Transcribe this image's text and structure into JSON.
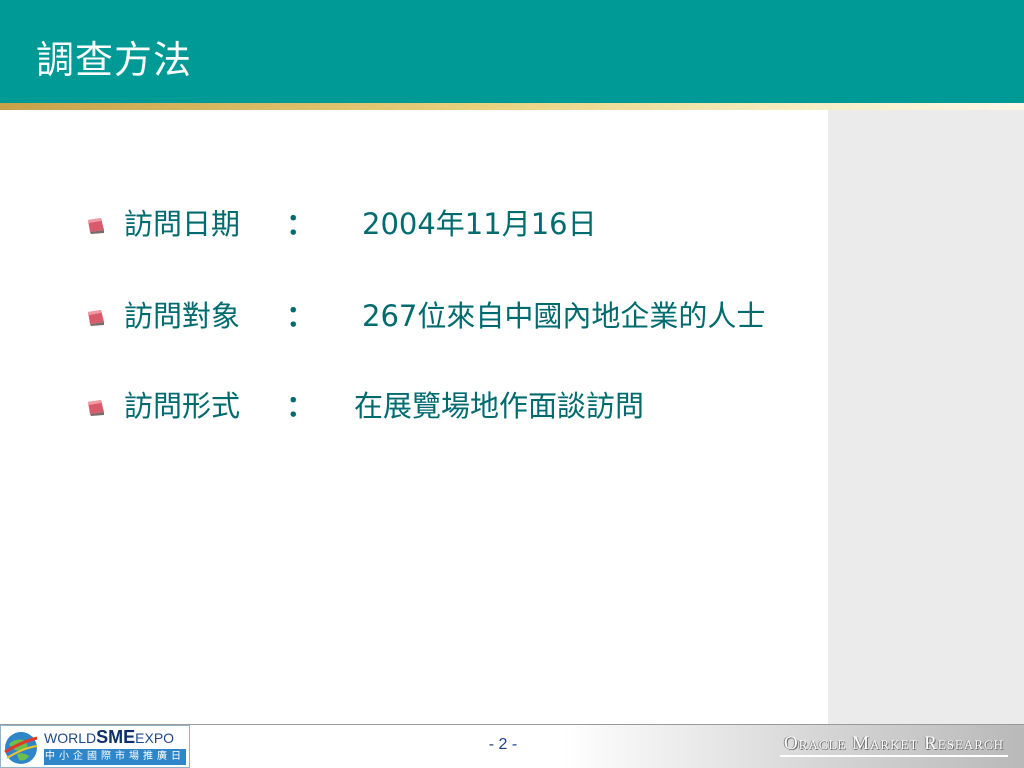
{
  "slide": {
    "title": "調查方法",
    "page_number": "- 2 -"
  },
  "bullets": [
    {
      "label": "訪問日期",
      "colon": "：",
      "value": "2004年11月16日"
    },
    {
      "label": "訪問對象",
      "colon": "：",
      "value": "267位來自中國內地企業的人士"
    },
    {
      "label": "訪問形式",
      "colon": "：",
      "value": "在展覽場地作面談訪問"
    }
  ],
  "footer": {
    "logo_world": "WORLD",
    "logo_sme": "SME",
    "logo_expo": "EXPO",
    "logo_chinese": "中小企國際市場推廣日",
    "brand": "Oracle Market Research"
  },
  "colors": {
    "header": "#009a96",
    "bullet_text": "#006b6f",
    "side_panel": "#ebebeb",
    "bullet_icon": "#d95a6a"
  },
  "icons": {
    "bullet": "square-bullet-icon",
    "logo": "globe-icon"
  }
}
